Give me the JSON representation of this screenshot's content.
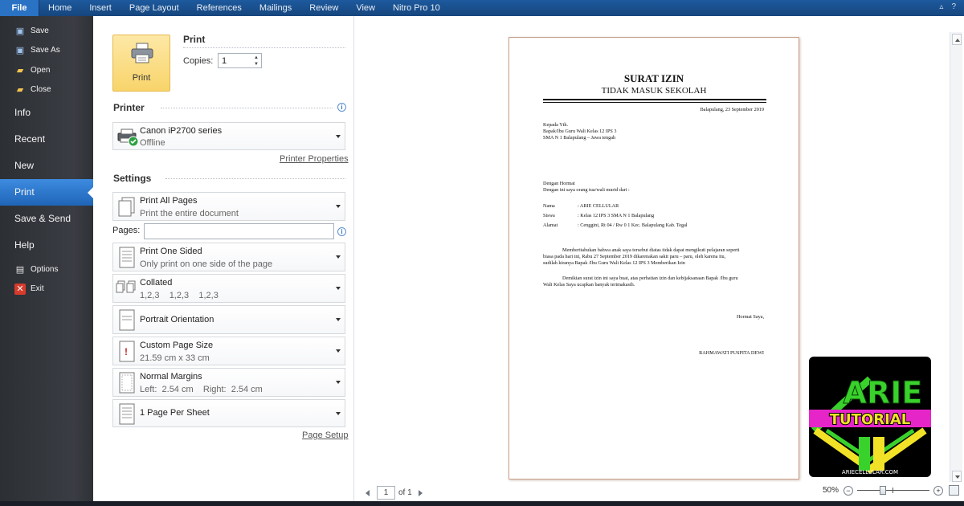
{
  "ribbon": {
    "tabs": [
      "File",
      "Home",
      "Insert",
      "Page Layout",
      "References",
      "Mailings",
      "Review",
      "View",
      "Nitro Pro 10"
    ]
  },
  "nav": {
    "save": "Save",
    "save_as": "Save As",
    "open": "Open",
    "close": "Close",
    "info": "Info",
    "recent": "Recent",
    "new": "New",
    "print": "Print",
    "save_send": "Save & Send",
    "help": "Help",
    "options": "Options",
    "exit": "Exit"
  },
  "print_section": {
    "heading": "Print",
    "button_label": "Print",
    "copies_label": "Copies:",
    "copies_value": "1"
  },
  "printer": {
    "heading": "Printer",
    "name": "Canon iP2700 series",
    "status": "Offline",
    "properties_link": "Printer Properties"
  },
  "settings": {
    "heading": "Settings",
    "pages_label": "Pages:",
    "pages_value": "",
    "items": [
      {
        "t1": "Print All Pages",
        "t2": "Print the entire document"
      },
      {
        "t1": "Print One Sided",
        "t2": "Only print on one side of the page"
      },
      {
        "t1": "Collated",
        "t2": "1,2,3    1,2,3    1,2,3"
      },
      {
        "t1": "Portrait Orientation",
        "t2": ""
      },
      {
        "t1": "Custom Page Size",
        "t2": "21.59 cm x 33 cm"
      },
      {
        "t1": "Normal Margins",
        "t2": "Left:  2.54 cm    Right:  2.54 cm"
      },
      {
        "t1": "1 Page Per Sheet",
        "t2": ""
      }
    ],
    "page_setup_link": "Page Setup"
  },
  "document": {
    "title": "SURAT IZIN",
    "subtitle": "TIDAK MASUK SEKOLAH",
    "date": "Balapulang, 23 September 2019",
    "to_lines": [
      "Kepada Yth.",
      "Bapak/Ibu Guru Wali Kelas 12 IPS 3",
      "SMA N 1 Balapulang – Jawa tengah"
    ],
    "greeting": "Dengan Hormat",
    "intro": "Dengan ini saya orang tua/wali murid dari :",
    "fields": [
      {
        "label": "Nama",
        "value": ": ARIE CELLULAR"
      },
      {
        "label": "Siswa",
        "value": ": Kelas 12 IPS 3 SMA N 1 Balapulang"
      },
      {
        "label": "Alamat",
        "value": ": Cenggini, Rt 04 / Rw 0 1 Kec. Balapulang Kab. Tegal"
      }
    ],
    "body1": [
      "Memberitahukan bahwa anak saya tersebut diatas tidak dapat mengikuti pelajaran seperti",
      "biasa pada hari ini, Rabu 27 September 2019 dikarenakan sakit paru – paru, oleh karena itu,",
      "sudilah kiranya Bapak /Ibu Guru Wali Kelas 12 IPS 3 Memberikan Izin"
    ],
    "body2": [
      "Demikian surat izin ini saya buat, atas perhatian izin dan kebijaksanaan Bapak /Ibu guru",
      "Wali Kelas Saya ucapkan banyak terimakasih."
    ],
    "closing": "Hormat Saya,",
    "signature": "RAHMAWATI PUSPITA DEWI"
  },
  "logo": {
    "line1": "ARIE",
    "line2": "TUTORIAL",
    "url": "ARIECELLULAR.COM",
    "colors": {
      "green": "#39d12b",
      "yellow": "#f2e227",
      "magenta": "#e625c8"
    }
  },
  "status_bar": {
    "page_current": "1",
    "page_total": "of 1",
    "zoom": "50%"
  },
  "colors": {
    "ribbon": "#1d5a9e",
    "nav_active": "#2f78d0",
    "print_button": "#f8d46a"
  }
}
